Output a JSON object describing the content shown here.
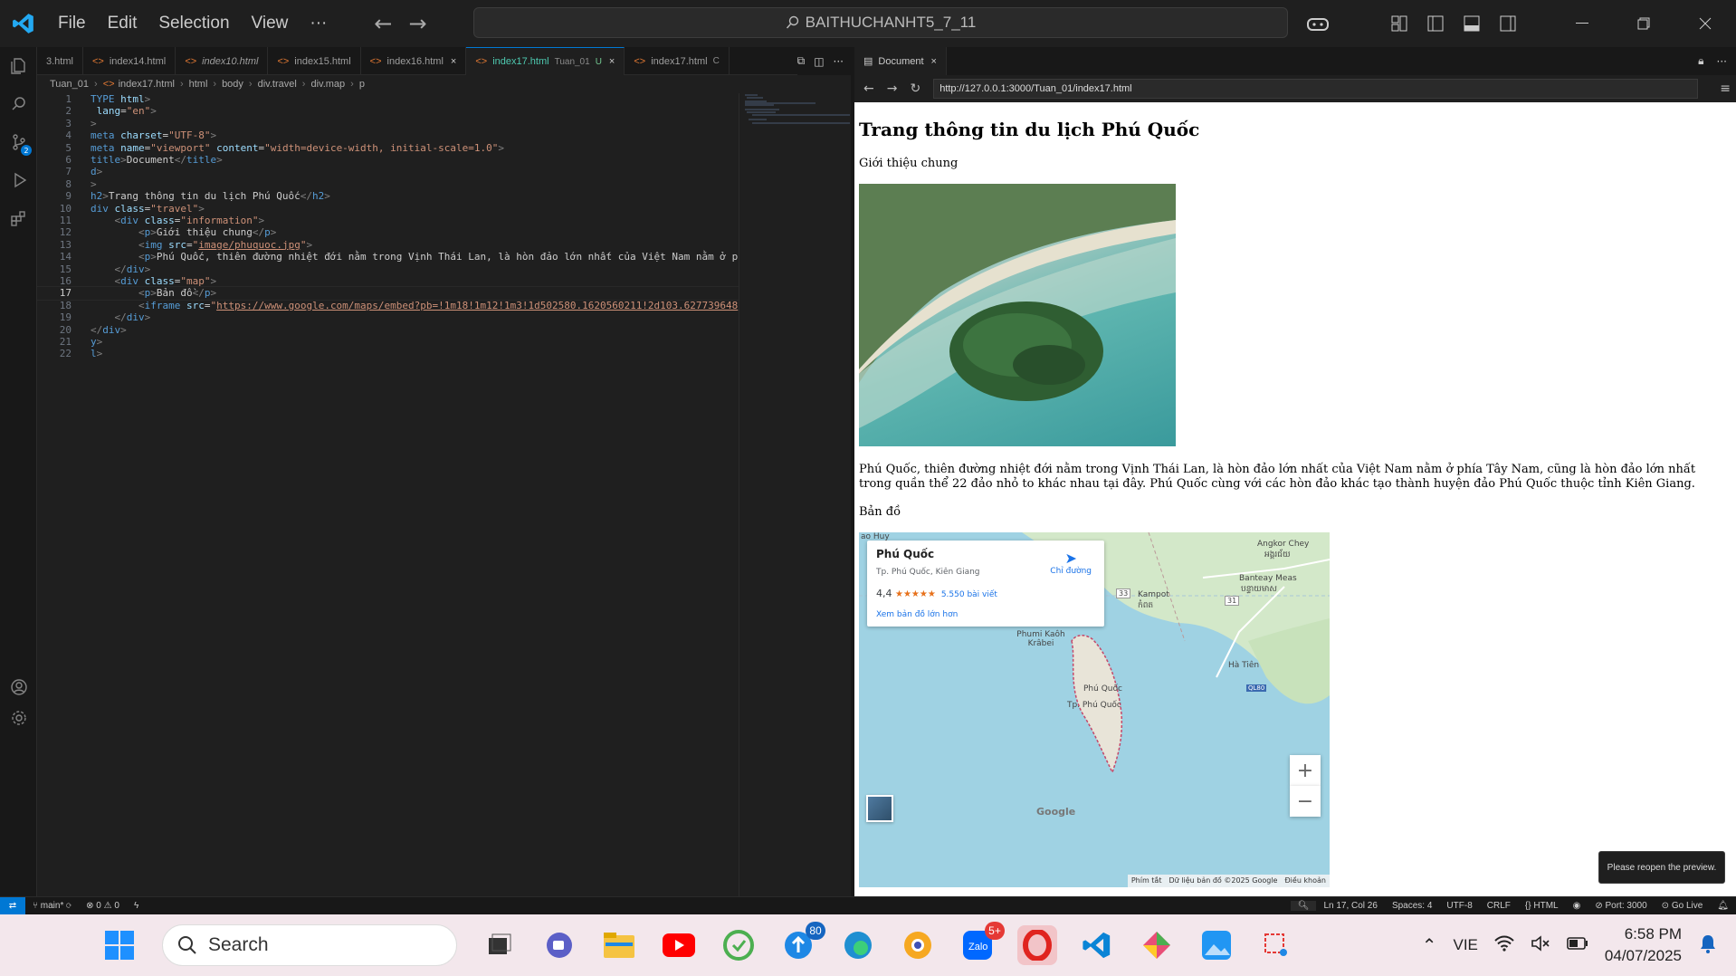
{
  "titlebar": {
    "menu": [
      "File",
      "Edit",
      "Selection",
      "View",
      "···"
    ],
    "command_center": "BAITHUCHANHT5_7_11"
  },
  "tabs": [
    {
      "label": "3.html",
      "active": false
    },
    {
      "label": "index14.html",
      "active": false
    },
    {
      "label": "index10.html",
      "active": false
    },
    {
      "label": "index15.html",
      "active": false
    },
    {
      "label": "index16.html",
      "active": false
    },
    {
      "label": "index17.html",
      "sub": "Tuan_01",
      "flag": "U",
      "active": true
    },
    {
      "label": "index17.html",
      "sub": "C",
      "active": false
    }
  ],
  "breadcrumb": [
    "Tuan_01",
    "index17.html",
    "html",
    "body",
    "div.travel",
    "div.map",
    "p"
  ],
  "editor": {
    "current_line": "17",
    "lines": [
      {
        "n": "1",
        "html": "<span class='t'>TYPE</span> <span class='a'>html</span><span class='g'>&gt;</span>"
      },
      {
        "n": "2",
        "html": " <span class='a'>lang</span>=<span class='s'>\"en\"</span><span class='g'>&gt;</span>"
      },
      {
        "n": "3",
        "html": "<span class='g'>&gt;</span>"
      },
      {
        "n": "4",
        "html": "<span class='t'>meta</span> <span class='a'>charset</span>=<span class='s'>\"UTF-8\"</span><span class='g'>&gt;</span>"
      },
      {
        "n": "5",
        "html": "<span class='t'>meta</span> <span class='a'>name</span>=<span class='s'>\"viewport\"</span> <span class='a'>content</span>=<span class='s'>\"width=device-width, initial-scale=1.0\"</span><span class='g'>&gt;</span>"
      },
      {
        "n": "6",
        "html": "<span class='t'>title</span><span class='g'>&gt;</span>Document<span class='g'>&lt;/</span><span class='t'>title</span><span class='g'>&gt;</span>"
      },
      {
        "n": "7",
        "html": "<span class='t'>d</span><span class='g'>&gt;</span>"
      },
      {
        "n": "8",
        "html": "<span class='g'>&gt;</span>"
      },
      {
        "n": "9",
        "html": "<span class='t'>h2</span><span class='g'>&gt;</span>Trang thông tin du lịch Phú Quốc<span class='g'>&lt;/</span><span class='t'>h2</span><span class='g'>&gt;</span>"
      },
      {
        "n": "10",
        "html": "<span class='t'>div</span> <span class='a'>class</span>=<span class='s'>\"travel\"</span><span class='g'>&gt;</span>"
      },
      {
        "n": "11",
        "html": "    <span class='g'>&lt;</span><span class='t'>div</span> <span class='a'>class</span>=<span class='s'>\"information\"</span><span class='g'>&gt;</span>"
      },
      {
        "n": "12",
        "html": "        <span class='g'>&lt;</span><span class='t'>p</span><span class='g'>&gt;</span>Giới thiệu chung<span class='g'>&lt;/</span><span class='t'>p</span><span class='g'>&gt;</span>"
      },
      {
        "n": "13",
        "html": "        <span class='g'>&lt;</span><span class='t'>img</span> <span class='a'>src</span>=<span class='s'>\"</span><span class='u'>image/phuquoc.jpg</span><span class='s'>\"</span><span class='g'>&gt;</span>"
      },
      {
        "n": "14",
        "html": "        <span class='g'>&lt;</span><span class='t'>p</span><span class='g'>&gt;</span>Phú Quốc, thiên đường nhiệt đới nằm trong Vịnh Thái Lan, là hòn đảo lớn nhất của Việt Nam nằm ở p"
      },
      {
        "n": "15",
        "html": "    <span class='g'>&lt;/</span><span class='t'>div</span><span class='g'>&gt;</span>"
      },
      {
        "n": "16",
        "html": "    <span class='g'>&lt;</span><span class='t'>div</span> <span class='a'>class</span>=<span class='s'>\"map\"</span><span class='g'>&gt;</span>"
      },
      {
        "n": "17",
        "html": "        <span class='g'>&lt;</span><span class='t'>p</span><span class='g'>&gt;</span>Bản đồ<span class='g'>&lt;/</span><span class='t'>p</span><span class='g'>&gt;</span>"
      },
      {
        "n": "18",
        "html": "        <span class='g'>&lt;</span><span class='t'>iframe</span> <span class='a'>src</span>=<span class='s'>\"</span><span class='u'>https://www.google.com/maps/embed?pb=!1m18!1m12!1m3!1d502580.1620560211!2d103.627739648</span>"
      },
      {
        "n": "19",
        "html": "    <span class='g'>&lt;/</span><span class='t'>div</span><span class='g'>&gt;</span>"
      },
      {
        "n": "20",
        "html": "<span class='g'>&lt;/</span><span class='t'>div</span><span class='g'>&gt;</span>"
      },
      {
        "n": "21",
        "html": "<span class='t'>y</span><span class='g'>&gt;</span>"
      },
      {
        "n": "22",
        "html": "<span class='t'>l</span><span class='g'>&gt;</span>"
      }
    ]
  },
  "preview": {
    "tab_label": "Document",
    "url": "http://127.0.0.1:3000/Tuan_01/index17.html",
    "heading": "Trang thông tin du lịch Phú Quốc",
    "intro": "Giới thiệu chung",
    "paragraph": "Phú Quốc, thiên đường nhiệt đới nằm trong Vịnh Thái Lan, là hòn đảo lớn nhất của Việt Nam nằm ở phía Tây Nam, cũng là hòn đảo lớn nhất trong quần thể 22 đảo nhỏ to khác nhau tại đây. Phú Quốc cùng với các hòn đảo khác tạo thành huyện đảo Phú Quốc thuộc tỉnh Kiên Giang.",
    "map_label": "Bản đồ",
    "map": {
      "place": "Phú Quốc",
      "address": "Tp. Phú Quốc, Kiên Giang",
      "rating": "4,4",
      "stars": "★★★★★",
      "reviews": "5.550 bài viết",
      "directions": "Chỉ đường",
      "larger_map": "Xem bản đồ lớn hơn",
      "labels": [
        "ao Huy",
        "Angkor Chey",
        "អង្គរជ័យ",
        "Banteay Meas",
        "បន្ទាយមាស",
        "Kampot",
        "កំពត",
        "Phumi Kaôh Krâbei",
        "Hà Tiên",
        "Phú Quốc",
        "Tp. Phú Quốc",
        "33",
        "31",
        "QL80"
      ],
      "footer": [
        "Phím tắt",
        "Dữ liệu bản đồ ©2025 Google",
        "Điều khoản"
      ],
      "logo": "Google"
    },
    "toast": "Please reopen the preview."
  },
  "statusbar": {
    "branch": "main*",
    "problems": "⊗ 0 ⚠ 0",
    "position": "Ln 17, Col 26",
    "spaces": "Spaces: 4",
    "encoding": "UTF-8",
    "eol": "CRLF",
    "language": "HTML",
    "port": "Port: 3000",
    "golive": "Go Live"
  },
  "taskbar": {
    "search_placeholder": "Search",
    "badge_teams": "80",
    "badge_zalo": "5+",
    "lang": "VIE",
    "time": "6:58 PM",
    "date": "04/07/2025"
  }
}
